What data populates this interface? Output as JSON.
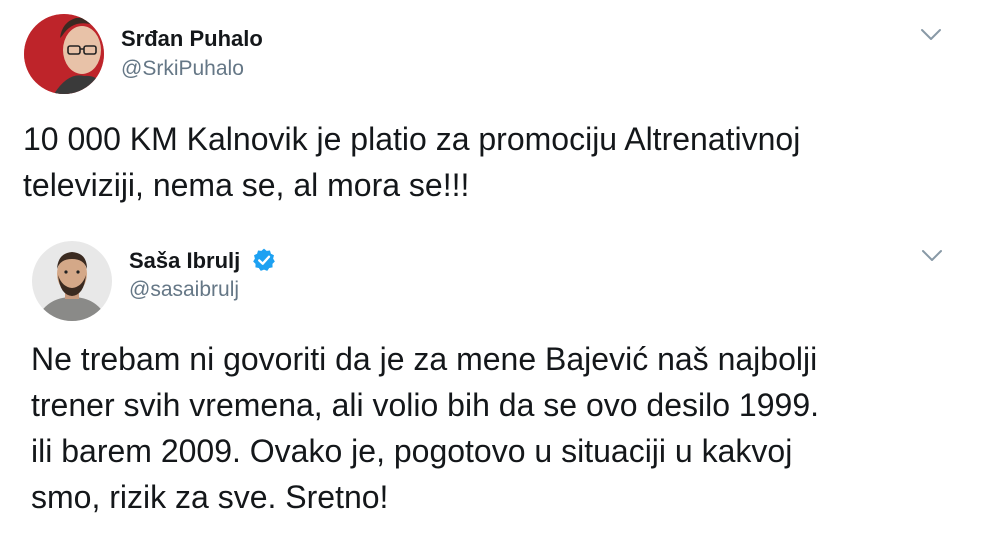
{
  "tweets": [
    {
      "display_name": "Srđan Puhalo",
      "handle": "@SrkiPuhalo",
      "verified": false,
      "avatar_icon": "user-avatar-photo",
      "menu_icon": "chevron-down-icon",
      "text_lines": [
        "10 000 KM Kalnovik je platio za promociju Altrenativnoj",
        "televiziji, nema se, al mora se!!!"
      ]
    },
    {
      "display_name": "Saša Ibrulj",
      "handle": "@sasaibrulj",
      "verified": true,
      "avatar_icon": "user-avatar-photo",
      "menu_icon": "chevron-down-icon",
      "text_lines": [
        "Ne trebam ni govoriti da je za mene Bajević naš najbolji",
        "trener svih vremena, ali volio bih da se ovo desilo 1999.",
        "ili barem 2009. Ovako je, pogotovo u situaciji u kakvoj",
        "smo, rizik za sve. Sretno!"
      ]
    }
  ],
  "colors": {
    "text": "#14171a",
    "handle": "#657786",
    "verified_badge": "#1da1f2",
    "chevron": "#8899a6",
    "avatar1_background": "#c8282e",
    "avatar2_background": "#e8e8e8"
  }
}
